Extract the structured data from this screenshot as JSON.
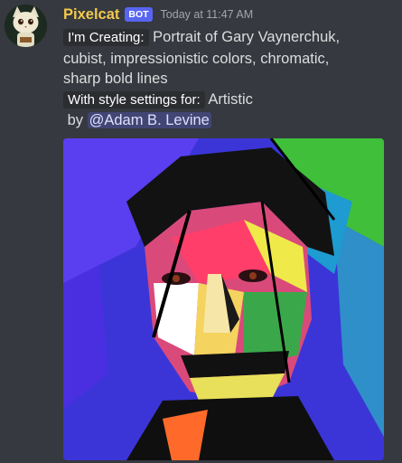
{
  "message": {
    "author": "Pixelcat",
    "bot_tag": "BOT",
    "timestamp": "Today at 11:47 AM",
    "creating_label": "I'm Creating:",
    "prompt_line1": "Portrait of Gary Vaynerchuk,",
    "prompt_line2": "cubist, impressionistic colors, chromatic,",
    "prompt_line3": "sharp bold lines",
    "style_label": "With style settings for:",
    "style_value": "Artistic",
    "by_label": "by",
    "mention": "@Adam B. Levine"
  },
  "colors": {
    "background": "#36393f",
    "username": "#f2c94c",
    "bot_tag": "#5865f2",
    "mention_bg": "#414675"
  },
  "image": {
    "type": "generated-artwork",
    "subject": "cubist portrait"
  }
}
